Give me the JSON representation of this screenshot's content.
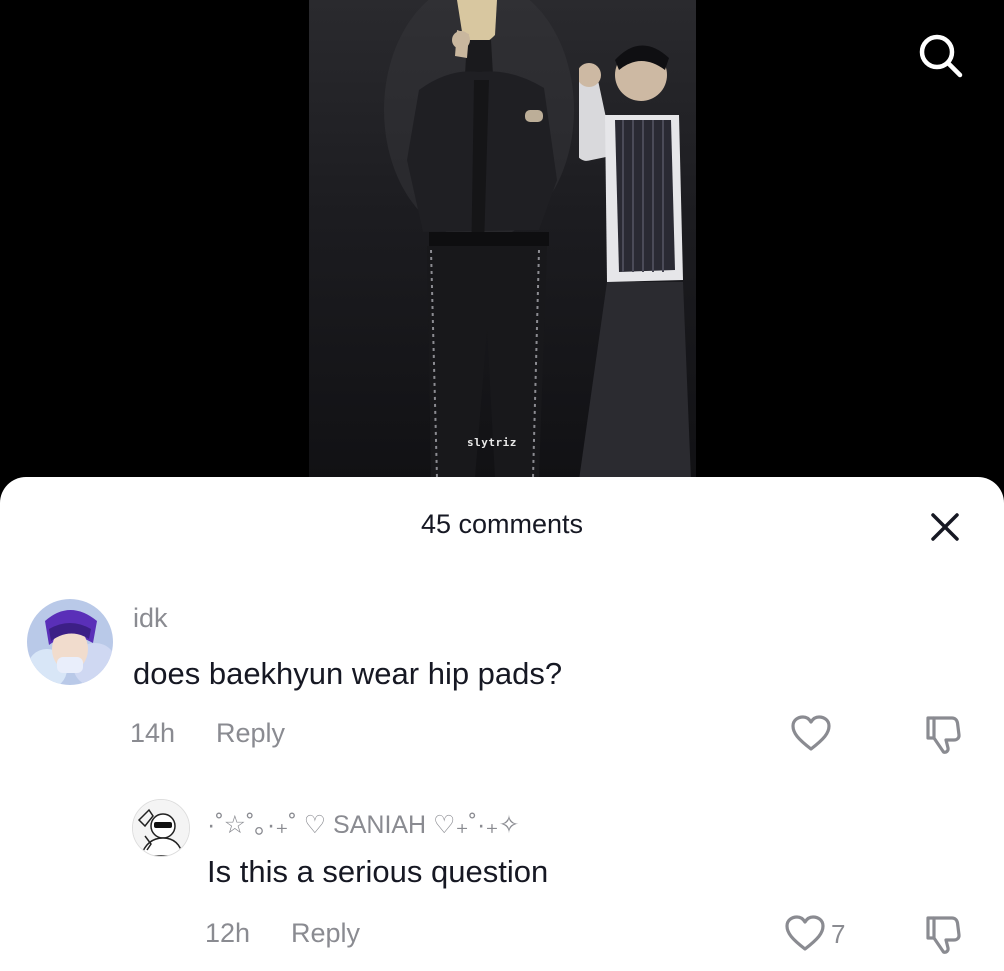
{
  "video": {
    "watermark": "slytriz"
  },
  "header": {
    "search_icon": "search-icon"
  },
  "comments_sheet": {
    "title": "45 comments",
    "close_icon": "close-icon",
    "comments": [
      {
        "username": "idk",
        "text": "does baekhyun wear hip pads?",
        "time": "14h",
        "reply_label": "Reply",
        "like_count": "",
        "avatar_icon": "avatar-purple-hair"
      },
      {
        "username": "·˚☆˚｡·₊˚ ♡ SANIAH ♡₊˚·₊✧",
        "text": "Is this a serious question",
        "time": "12h",
        "reply_label": "Reply",
        "like_count": "7",
        "avatar_icon": "avatar-sketch"
      }
    ]
  },
  "colors": {
    "sheet_bg": "#ffffff",
    "text_primary": "#161823",
    "text_secondary": "#8a8b91",
    "video_bg": "#000000"
  }
}
